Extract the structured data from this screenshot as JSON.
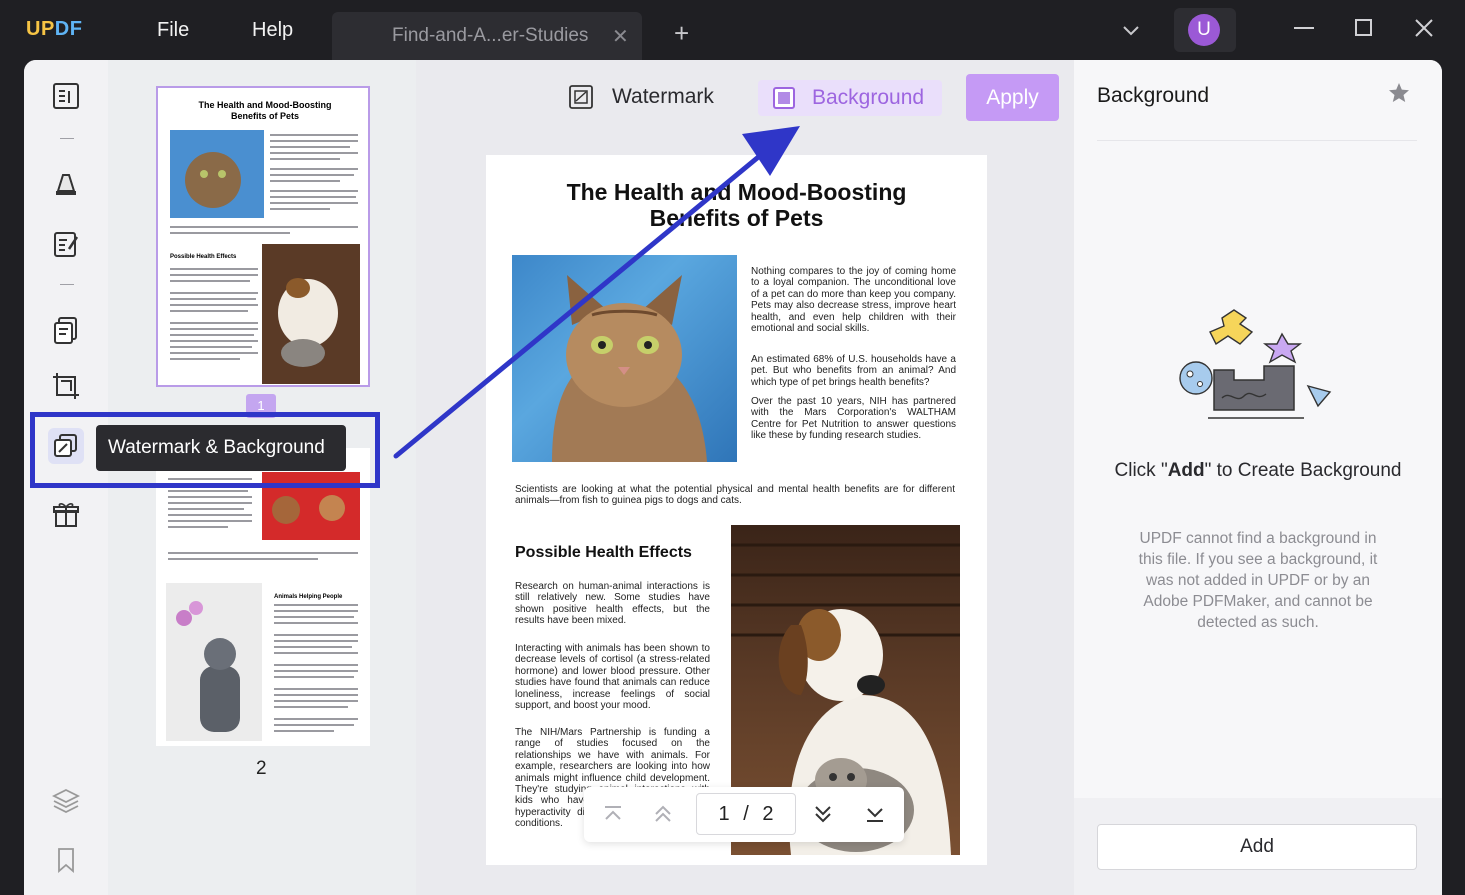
{
  "titlebar": {
    "logo": "UPDF",
    "menu": [
      "File",
      "Help"
    ],
    "tab_title": "Find-and-A...er-Studies",
    "avatar_initial": "U"
  },
  "toolbar": {
    "watermark_label": "Watermark",
    "background_label": "Background",
    "apply_label": "Apply"
  },
  "sidebar": {
    "tooltip": "Watermark & Background"
  },
  "thumbnails": {
    "page1_badge": "1",
    "page2_label": "2"
  },
  "document": {
    "title_line1": "The Health and Mood-Boosting",
    "title_line2": "Benefits of Pets",
    "para1": "Nothing compares to the joy of coming home to a loyal companion. The unconditional love of a pet can do more than keep you company. Pets may also decrease stress, improve heart health, and even help children with their emotional and social skills.",
    "para2": "An estimated 68% of U.S. households have a pet. But who benefits from an animal? And which type of pet brings health benefits?",
    "para3": "Over the past 10 years, NIH has partnered with the Mars Corporation's WALTHAM Centre for Pet Nutrition to answer questions like these by funding research studies.",
    "para4": "Scientists are looking at what the potential physical and mental health benefits are for different animals—from fish to guinea pigs to dogs and cats.",
    "heading2": "Possible Health Effects",
    "para5": "Research on human-animal interactions is still relatively new. Some studies have shown positive health effects, but the results have been mixed.",
    "para6": "Interacting with animals has been shown to decrease levels of cortisol (a stress-related hormone) and lower blood pressure. Other studies have found that animals can reduce loneliness, increase feelings of social support, and boost your mood.",
    "para7": "The NIH/Mars Partnership is funding a range of studies focused on the relationships we have with animals. For example, researchers are looking into how animals might influence child development. They're studying animal interactions with kids who have autism, attention deficit hyperactivity disorder (ADHD), and other conditions."
  },
  "pager": {
    "current": "1",
    "separator": "/",
    "total": "2"
  },
  "panel": {
    "title": "Background",
    "heading_pre": "Click \"",
    "heading_bold": "Add",
    "heading_post": "\" to Create Background",
    "description": "UPDF cannot find a background in this file. If you see a background, it was not added in UPDF or by an Adobe PDFMaker, and cannot be detected as such.",
    "add_label": "Add"
  },
  "colors": {
    "accent": "#c59af5",
    "accent_text": "#9d65e0",
    "highlight_border": "#2f36c8",
    "arrow": "#2f36c8"
  }
}
